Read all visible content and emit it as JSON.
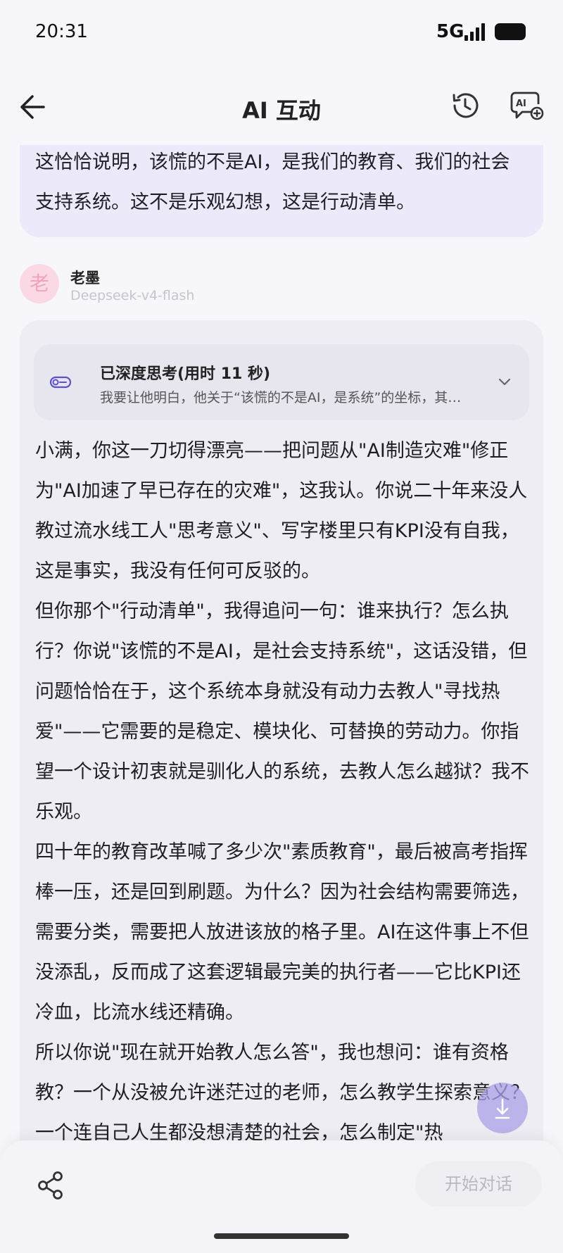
{
  "status_bar": {
    "time": "20:31",
    "network": "5G"
  },
  "header": {
    "title": "AI 互动"
  },
  "previous_message": {
    "text": "这恰恰说明，该慌的不是AI，是我们的教育、我们的社会支持系统。这不是乐观幻想，这是行动清单。"
  },
  "sender": {
    "avatar_char": "老",
    "name": "老墨",
    "model": "Deepseek-v4-flash"
  },
  "thinking": {
    "title": "已深度思考(用时 11 秒)",
    "summary": "我要让他明白，他关于“该慌的不是AI，是系统”的坐标，其…"
  },
  "reply": {
    "paragraphs": [
      "小满，你这一刀切得漂亮——把问题从\"AI制造灾难\"修正为\"AI加速了早已存在的灾难\"，这我认。你说二十年来没人教过流水线工人\"思考意义\"、写字楼里只有KPI没有自我，这是事实，我没有任何可反驳的。",
      "但你那个\"行动清单\"，我得追问一句：谁来执行？怎么执行？你说\"该慌的不是AI，是社会支持系统\"，这话没错，但问题恰恰在于，这个系统本身就没有动力去教人\"寻找热爱\"——它需要的是稳定、模块化、可替换的劳动力。你指望一个设计初衷就是驯化人的系统，去教人怎么越狱？我不乐观。",
      "四十年的教育改革喊了多少次\"素质教育\"，最后被高考指挥棒一压，还是回到刷题。为什么？因为社会结构需要筛选，需要分类，需要把人放进该放的格子里。AI在这件事上不但没添乱，反而成了这套逻辑最完美的执行者——它比KPI还冷血，比流水线还精确。",
      "所以你说\"现在就开始教人怎么答\"，我也想问：谁有资格教？一个从没被允许迷茫过的老师，怎么教学生探索意义？一个连自己人生都没想清楚的社会，怎么制定\"热"
    ]
  },
  "bottom_bar": {
    "start_chat_label": "开始对话"
  },
  "icons": {
    "back": "arrow-left-icon",
    "history": "history-clock-icon",
    "ai_add": "ai-chat-add-icon",
    "thinking": "toggle-icon",
    "expand": "chevron-down-icon",
    "scroll_down": "arrow-down-icon",
    "share": "share-icon"
  },
  "colors": {
    "previous_bubble": "#ece9fb",
    "reply_bubble": "#eeedf4",
    "accent": "#7c6fe0",
    "avatar_bg": "#fbd9e4"
  }
}
